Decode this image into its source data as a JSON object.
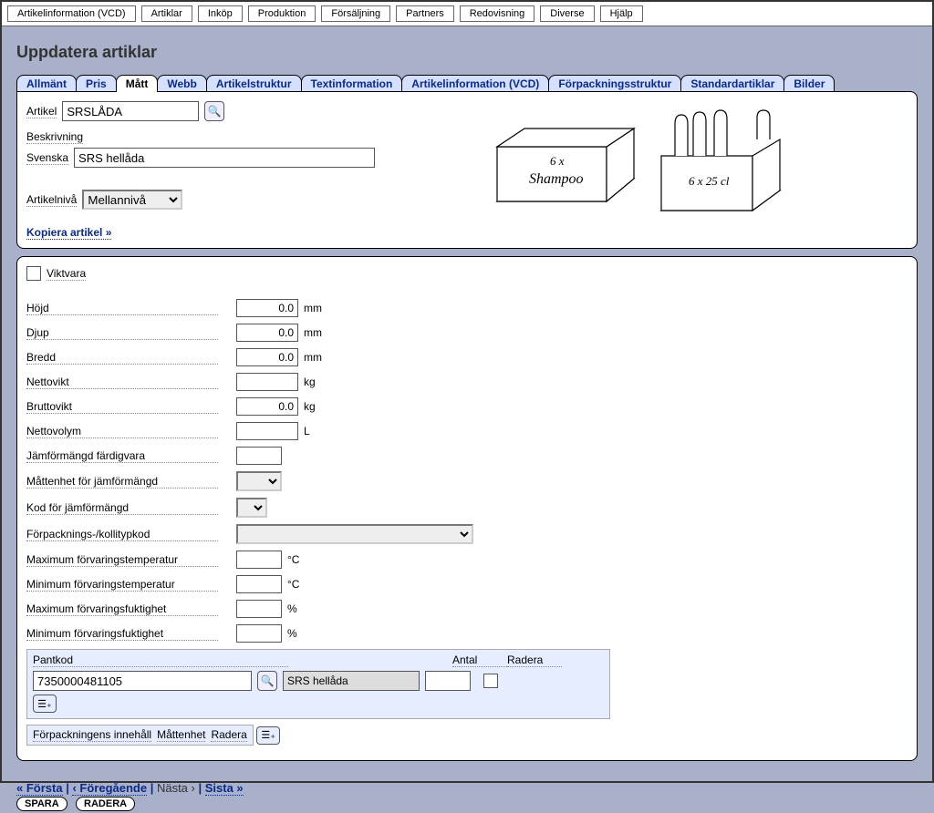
{
  "topbar": [
    "Artikelinformation (VCD)",
    "Artiklar",
    "Inköp",
    "Produktion",
    "Försäljning",
    "Partners",
    "Redovisning",
    "Diverse",
    "Hjälp"
  ],
  "page_title": "Uppdatera artiklar",
  "tabs": [
    "Allmänt",
    "Pris",
    "Mått",
    "Webb",
    "Artikelstruktur",
    "Textinformation",
    "Artikelinformation (VCD)",
    "Förpackningsstruktur",
    "Standardartiklar",
    "Bilder"
  ],
  "active_tab_index": 2,
  "header": {
    "artikel_label": "Artikel",
    "artikel_value": "SRSLÅDA",
    "beskrivning_label": "Beskrivning",
    "svenska_label": "Svenska",
    "svenska_value": "SRS hellåda",
    "artikelniva_label": "Artikelnivå",
    "artikelniva_value": "Mellannivå",
    "kopiera_link": "Kopiera artikel »"
  },
  "illustration": {
    "box_text1": "6 x",
    "box_text2": "Shampoo",
    "pack_text": "6 x 25 cl"
  },
  "form": {
    "viktvara_label": "Viktvara",
    "viktvara_checked": false,
    "fields": [
      {
        "label": "Höjd",
        "value": "0.0",
        "unit": "mm",
        "type": "num"
      },
      {
        "label": "Djup",
        "value": "0.0",
        "unit": "mm",
        "type": "num"
      },
      {
        "label": "Bredd",
        "value": "0.0",
        "unit": "mm",
        "type": "num"
      },
      {
        "label": "Nettovikt",
        "value": "",
        "unit": "kg",
        "type": "num"
      },
      {
        "label": "Bruttovikt",
        "value": "0.0",
        "unit": "kg",
        "type": "num"
      },
      {
        "label": "Nettovolym",
        "value": "",
        "unit": "L",
        "type": "num"
      },
      {
        "label": "Jämförmängd färdigvara",
        "value": "",
        "unit": "",
        "type": "num-short"
      },
      {
        "label": "Måttenhet för jämförmängd",
        "value": "",
        "unit": "",
        "type": "select-short"
      },
      {
        "label": "Kod för jämförmängd",
        "value": "",
        "unit": "",
        "type": "select-tiny"
      },
      {
        "label": "Förpacknings-/kollitypkod",
        "value": "",
        "unit": "",
        "type": "select-wide"
      },
      {
        "label": "Maximum förvaringstemperatur",
        "value": "",
        "unit": "°C",
        "type": "num-short"
      },
      {
        "label": "Minimum förvaringstemperatur",
        "value": "",
        "unit": "°C",
        "type": "num-short"
      },
      {
        "label": "Maximum förvaringsfuktighet",
        "value": "",
        "unit": "%",
        "type": "num-short"
      },
      {
        "label": "Minimum förvaringsfuktighet",
        "value": "",
        "unit": "%",
        "type": "num-short"
      }
    ]
  },
  "pantkod": {
    "head_pantkod": "Pantkod",
    "head_antal": "Antal",
    "head_radera": "Radera",
    "rows": [
      {
        "code": "7350000481105",
        "desc": "SRS hellåda",
        "antal": "",
        "radera": false
      }
    ]
  },
  "inner_table": {
    "col1": "Förpackningens innehåll",
    "col2": "Måttenhet",
    "col3": "Radera"
  },
  "nav": {
    "first": "« Första",
    "prev": "‹ Föregående",
    "next": "Nästa ›",
    "last": "Sista »",
    "sep": " | "
  },
  "actions": {
    "save": "SPARA",
    "delete": "RADERA"
  }
}
